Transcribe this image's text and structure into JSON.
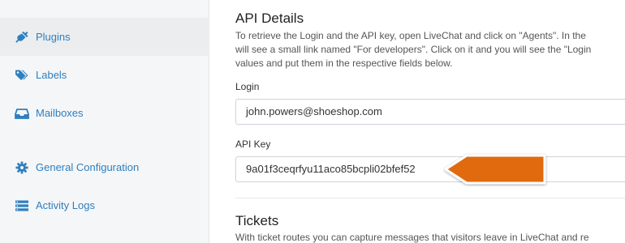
{
  "sidebar": {
    "items": [
      {
        "label": "Plugins",
        "icon": "plug-icon",
        "active": true
      },
      {
        "label": "Labels",
        "icon": "tag-icon",
        "active": false
      },
      {
        "label": "Mailboxes",
        "icon": "inbox-icon",
        "active": false
      },
      {
        "label": "General Configuration",
        "icon": "gear-icon",
        "active": false
      },
      {
        "label": "Activity Logs",
        "icon": "list-icon",
        "active": false
      }
    ]
  },
  "api_details": {
    "title": "API Details",
    "description": [
      "To retrieve the Login and the API key, open LiveChat and click on \"Agents\". In the",
      "will see a small link named \"For developers\". Click on it and you will see the \"Login",
      "values and put them in the respective fields below."
    ],
    "login_label": "Login",
    "login_value": "john.powers@shoeshop.com",
    "api_key_label": "API Key",
    "api_key_value": "9a01f3ceqrfyu11aco85bcpli02bfef52"
  },
  "tickets": {
    "title": "Tickets",
    "description": "With ticket routes you can capture messages that visitors leave in LiveChat and re"
  },
  "colors": {
    "accent": "#2e7fbf",
    "annotation_arrow": "#e06a10"
  }
}
